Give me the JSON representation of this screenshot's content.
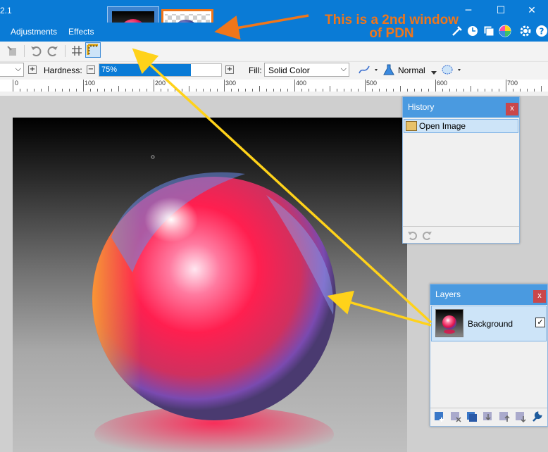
{
  "window": {
    "title": "2.1",
    "minimize_glyph": "─",
    "maximize_glyph": "☐",
    "close_glyph": "✕"
  },
  "menu": {
    "adjustments": "Adjustments",
    "effects": "Effects"
  },
  "image_tabs": [
    {
      "name": "glass-sphere-red",
      "active": true
    },
    {
      "name": "glass-sphere-blue-transparent",
      "active": false
    }
  ],
  "toolbar": {
    "hardness_label": "Hardness:",
    "hardness_value": "75%",
    "hardness_level": 0.75,
    "fill_label": "Fill:",
    "fill_value": "Solid Color",
    "blend_mode": "Normal",
    "plus_glyph": "+",
    "minus_glyph": "−",
    "dropdown_glyph": "⌵"
  },
  "ruler": {
    "labels": [
      "0",
      "100",
      "200",
      "300",
      "400",
      "500",
      "600",
      "700"
    ]
  },
  "annotation": {
    "line1": "This is a 2nd window",
    "line2": "of PDN",
    "color": "#f0761a",
    "arrow_color": "#ffd21a"
  },
  "history": {
    "title": "History",
    "close_glyph": "x",
    "items": [
      "Open Image"
    ]
  },
  "layers": {
    "title": "Layers",
    "close_glyph": "x",
    "items": [
      {
        "name": "Background",
        "visible": true,
        "check_glyph": "✓"
      }
    ]
  },
  "colors": {
    "titlebar": "#0a7bd6",
    "panel_header": "#4a9ae0",
    "selection": "#cde4f8",
    "close": "#c9474b"
  }
}
